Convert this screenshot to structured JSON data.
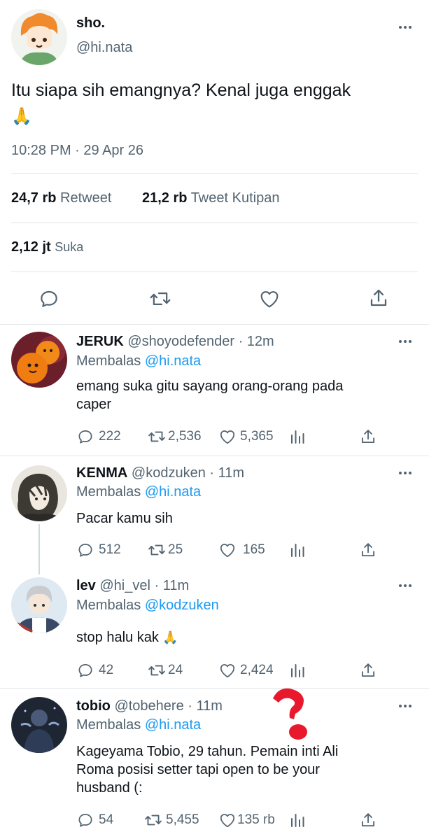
{
  "main_tweet": {
    "display_name": "sho.",
    "handle": "@hi.nata",
    "text": "Itu siapa sih emangnya? Kenal juga enggak",
    "emoji": "🙏",
    "timestamp": "10:28 PM · 29 Apr 26",
    "retweet_count": "24,7 rb",
    "retweet_label": "Retweet",
    "quote_count": "21,2 rb",
    "quote_label": "Tweet Kutipan",
    "like_count": "2,12 jt",
    "like_label": "Suka"
  },
  "replies": [
    {
      "name": "JERUK",
      "handle": "@shoyodefender",
      "time": "12m",
      "reply_prefix": "Membalas",
      "reply_to": "@hi.nata",
      "text_line1": "emang suka gitu sayang orang-orang pada",
      "text_line2": "caper",
      "replies": "222",
      "retweets": "2,536",
      "likes": "5,365"
    },
    {
      "name": "KENMA",
      "handle": "@kodzuken",
      "time": "11m",
      "reply_prefix": "Membalas",
      "reply_to": "@hi.nata",
      "text_line1": "Pacar kamu sih",
      "replies": "512",
      "retweets": "25",
      "likes": "165"
    },
    {
      "name": "lev",
      "handle": "@hi_vel",
      "time": "11m",
      "reply_prefix": "Membalas",
      "reply_to": "@kodzuken",
      "text_line1": "stop halu kak",
      "emoji": "🙏",
      "replies": "42",
      "retweets": "24",
      "likes": "2,424"
    },
    {
      "name": "tobio",
      "handle": "@tobehere",
      "time": "11m",
      "reply_prefix": "Membalas",
      "reply_to": "@hi.nata",
      "text_line1": "Kageyama Tobio, 29 tahun. Pemain inti Ali",
      "text_line2": "Roma posisi setter tapi open to be your",
      "text_line3": "husband (:",
      "replies": "54",
      "retweets": "5,455",
      "likes": "135 rb"
    }
  ],
  "sep": "·",
  "colors": {
    "link": "#1d9bf0",
    "muted": "#536471",
    "annotation": "#e8192c"
  },
  "icons": [
    "more-icon",
    "reply-icon",
    "retweet-icon",
    "like-icon",
    "share-icon",
    "analytics-icon"
  ]
}
